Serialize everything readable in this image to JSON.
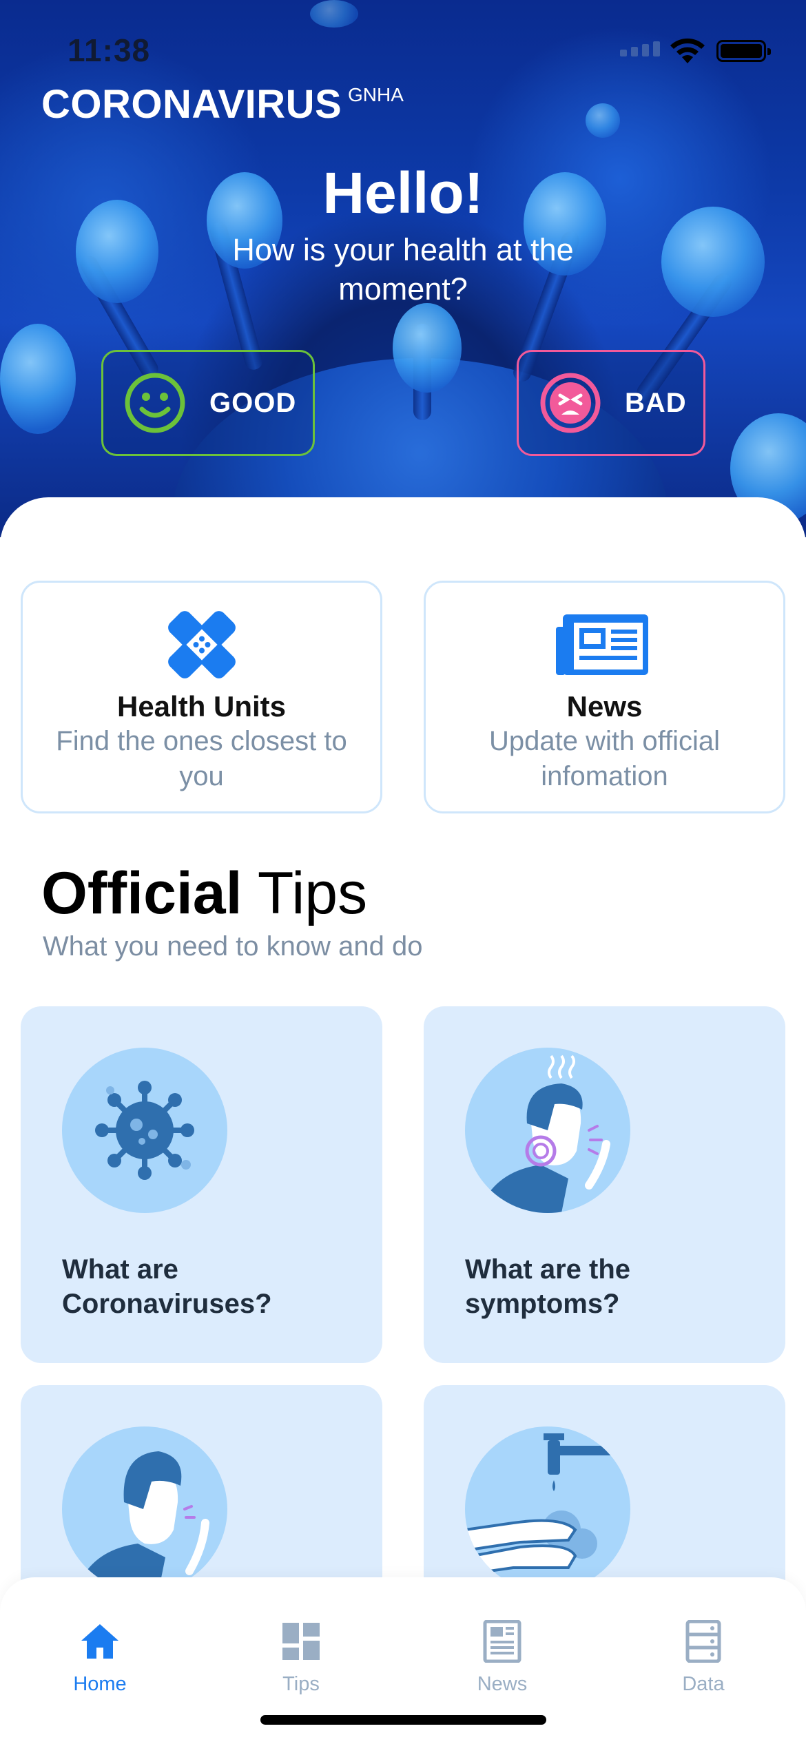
{
  "status_bar": {
    "time": "11:38"
  },
  "brand": {
    "name": "CORONAVIRUS",
    "superscript": "GNHA"
  },
  "greeting": {
    "title": "Hello!",
    "question": "How is your health at the moment?"
  },
  "mood": {
    "good_label": "GOOD",
    "bad_label": "BAD",
    "good_color": "#6cc23a",
    "bad_color": "#f25a9a"
  },
  "quick_cards": [
    {
      "title": "Health Units",
      "subtitle": "Find the ones closest to you",
      "icon": "bandage-icon"
    },
    {
      "title": "News",
      "subtitle": "Update with official infomation",
      "icon": "newspaper-icon"
    }
  ],
  "tips": {
    "title_bold": "Official",
    "title_rest": "Tips",
    "subtitle": "What you need to know and do",
    "cards": [
      {
        "title": "What are Coronaviruses?",
        "icon": "virus-icon"
      },
      {
        "title": "What are the symptoms?",
        "icon": "sick-person-icon"
      },
      {
        "title": "",
        "icon": "coughing-person-icon"
      },
      {
        "title": "",
        "icon": "hand-washing-icon"
      }
    ]
  },
  "tabbar": {
    "items": [
      {
        "label": "Home",
        "icon": "home-icon",
        "active": true
      },
      {
        "label": "Tips",
        "icon": "tips-grid-icon",
        "active": false
      },
      {
        "label": "News",
        "icon": "news-icon",
        "active": false
      },
      {
        "label": "Data",
        "icon": "data-icon",
        "active": false
      }
    ]
  },
  "colors": {
    "accent": "#1b7cf0",
    "card_bg": "#dcecfd",
    "muted_text": "#7b8fa5"
  }
}
